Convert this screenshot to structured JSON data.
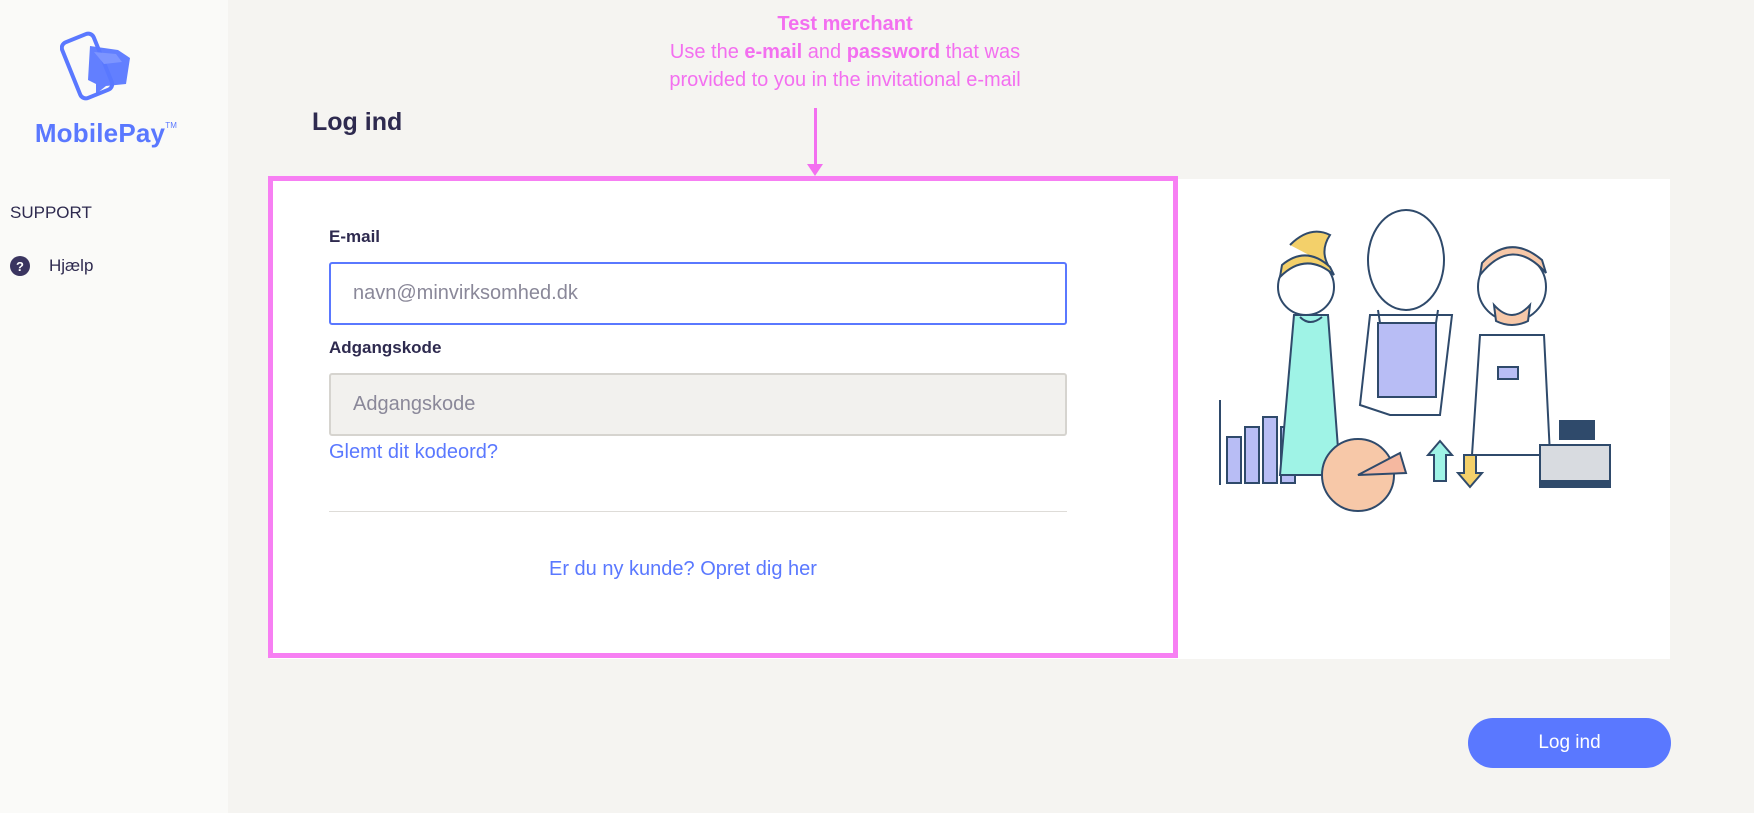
{
  "brand": {
    "name": "MobilePay",
    "trademark": "TM",
    "accent_color": "#5a78ff"
  },
  "sidebar": {
    "section_heading": "SUPPORT",
    "items": [
      {
        "label": "Hjælp",
        "icon": "question-circle-icon"
      }
    ]
  },
  "annotation": {
    "color": "#f36ff0",
    "title": "Test merchant",
    "line1_pre": "Use the",
    "line1_bold1": "e-mail",
    "line1_mid": "and",
    "line1_bold2": "password",
    "line1_post": "that was",
    "line2": "provided to you in the invitational e-mail"
  },
  "page": {
    "title": "Log ind"
  },
  "form": {
    "email": {
      "label": "E-mail",
      "value": "",
      "placeholder": "navn@minvirksomhed.dk"
    },
    "password": {
      "label": "Adgangskode",
      "value": "",
      "placeholder": "Adgangskode"
    },
    "forgot_link": "Glemt dit kodeord?",
    "signup_link": "Er du ny kunde? Opret dig her"
  },
  "actions": {
    "submit_label": "Log ind"
  }
}
